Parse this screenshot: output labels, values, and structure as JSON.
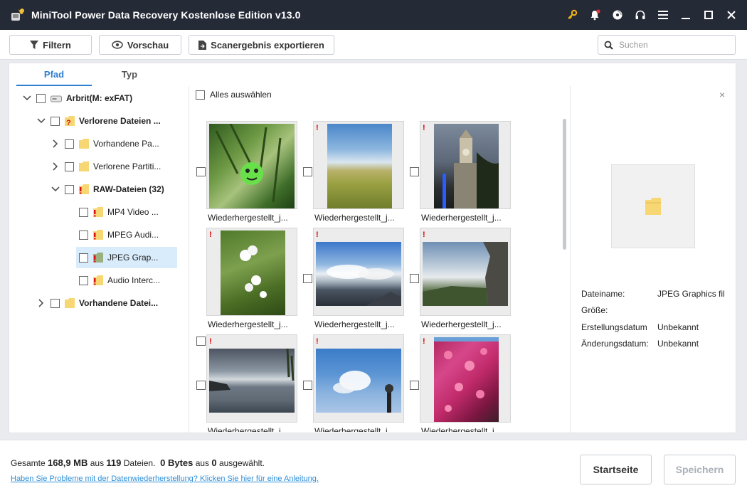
{
  "window": {
    "title": "MiniTool Power Data Recovery Kostenlose Edition v13.0",
    "icons": [
      "key-icon",
      "bell-icon",
      "disc-icon",
      "headset-icon",
      "menu-icon",
      "minimize-icon",
      "maximize-icon",
      "close-icon"
    ]
  },
  "toolbar": {
    "filter_label": "Filtern",
    "preview_label": "Vorschau",
    "export_label": "Scanergebnis exportieren",
    "search_placeholder": "Suchen"
  },
  "tabs": {
    "path": "Pfad",
    "type": "Typ"
  },
  "tree": {
    "root": "Arbrit(M: exFAT)",
    "lost": "Verlorene Dateien ...",
    "existing_partition": "Vorhandene Pa...",
    "lost_partition": "Verlorene Partiti...",
    "raw": "RAW-Dateien (32)",
    "mp4": "MP4 Video ...",
    "mpeg": "MPEG Audi...",
    "jpeg": "JPEG Grap...",
    "audio": "Audio Interc...",
    "existing": "Vorhandene Datei..."
  },
  "select_all": "Alles auswählen",
  "files": [
    {
      "name": "Wiederhergestellt_j..."
    },
    {
      "name": "Wiederhergestellt_j..."
    },
    {
      "name": "Wiederhergestellt_j..."
    },
    {
      "name": "Wiederhergestellt_j..."
    },
    {
      "name": "Wiederhergestellt_j..."
    },
    {
      "name": "Wiederhergestellt_j..."
    },
    {
      "name": "Wiederhergestellt_j..."
    },
    {
      "name": "Wiederhergestellt_j..."
    },
    {
      "name": "Wiederhergestellt_j..."
    }
  ],
  "preview": {
    "close": "×",
    "filename_label": "Dateiname:",
    "filename_value": "JPEG Graphics fil",
    "size_label": "Größe:",
    "size_value": "",
    "created_label": "Erstellungsdatum",
    "created_value": "Unbekannt",
    "modified_label": "Änderungsdatum:",
    "modified_value": "Unbekannt"
  },
  "footer": {
    "total_prefix": "Gesamte ",
    "total_size": "168,9 MB",
    "total_mid": " aus ",
    "total_count": "119",
    "total_suffix": " Dateien.",
    "selected_bytes": "0 Bytes",
    "selected_mid": " aus ",
    "selected_count": "0",
    "selected_suffix": " ausgewählt.",
    "help_link": "Haben Sie Probleme mit der Datenwiederherstellung? Klicken Sie hier für eine Anleitung.",
    "home_button": "Startseite",
    "save_button": "Speichern"
  }
}
